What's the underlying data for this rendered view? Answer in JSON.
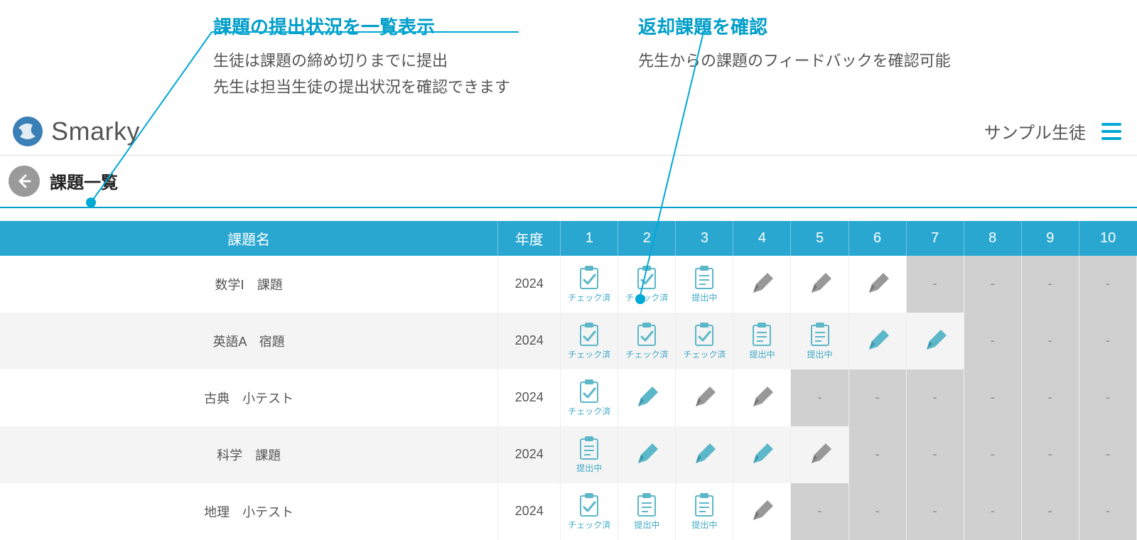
{
  "annotations": {
    "left": {
      "title": "課題の提出状況を一覧表示",
      "body1": "生徒は課題の締め切りまでに提出",
      "body2": "先生は担当生徒の提出状況を確認できます"
    },
    "right": {
      "title": "返却課題を確認",
      "body1": "先生からの課題のフィードバックを確認可能"
    }
  },
  "header": {
    "app_name": "Smarky",
    "user": "サンプル生徒"
  },
  "page": {
    "title": "課題一覧"
  },
  "status_labels": {
    "checked": "チェック済",
    "submitting": "提出中",
    "dash": "-"
  },
  "table": {
    "headers": {
      "name": "課題名",
      "year": "年度",
      "cols": [
        "1",
        "2",
        "3",
        "4",
        "5",
        "6",
        "7",
        "8",
        "9",
        "10"
      ]
    },
    "rows": [
      {
        "name": "数学Ⅰ　課題",
        "year": "2024",
        "cells": [
          "checked",
          "checked",
          "submitting",
          "pencil_gray",
          "pencil_gray",
          "pencil_gray",
          "disabled",
          "disabled",
          "disabled",
          "disabled"
        ]
      },
      {
        "name": "英語A　宿題",
        "year": "2024",
        "cells": [
          "checked",
          "checked",
          "checked",
          "submitting",
          "submitting",
          "pencil_teal",
          "pencil_teal",
          "disabled",
          "disabled",
          "disabled"
        ]
      },
      {
        "name": "古典　小テスト",
        "year": "2024",
        "cells": [
          "checked",
          "pencil_teal",
          "pencil_gray",
          "pencil_gray",
          "disabled",
          "disabled",
          "disabled",
          "disabled",
          "disabled",
          "disabled"
        ]
      },
      {
        "name": "科学　課題",
        "year": "2024",
        "cells": [
          "submitting",
          "pencil_teal",
          "pencil_teal",
          "pencil_teal",
          "pencil_gray",
          "disabled",
          "disabled",
          "disabled",
          "disabled",
          "disabled"
        ]
      },
      {
        "name": "地理　小テスト",
        "year": "2024",
        "cells": [
          "checked",
          "submitting",
          "submitting",
          "pencil_gray",
          "disabled",
          "disabled",
          "disabled",
          "disabled",
          "disabled",
          "disabled"
        ]
      }
    ]
  }
}
